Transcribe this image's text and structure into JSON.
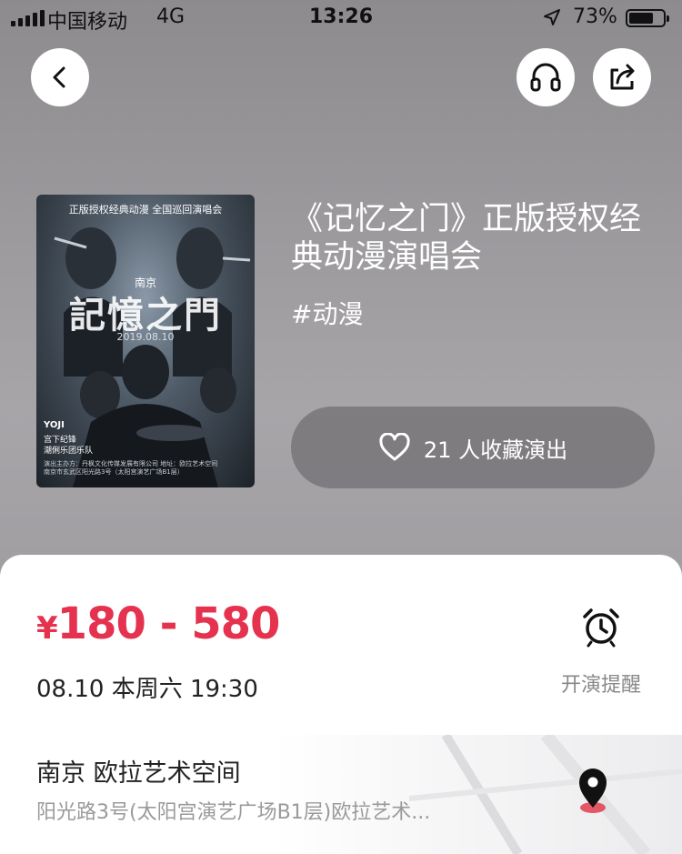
{
  "status_bar": {
    "carrier": "中国移动",
    "network": "4G",
    "time": "13:26",
    "battery_pct": "73%",
    "battery_level": 0.73
  },
  "header": {
    "back_icon": "chevron-left-icon",
    "audio_icon": "headphones-icon",
    "share_icon": "share-icon"
  },
  "poster": {
    "top_text": "正版授权经典动漫 全国巡回演唱会",
    "city": "南京",
    "title_art": "記憶之門",
    "date": "2019.08.10",
    "artist_1": "YOJI",
    "artist_2": "宫下纪锋",
    "artist_3": "潮俐乐团乐队",
    "fine_print": "演出主办方：丹枫文化传媒发展有限公司 地址：欧拉艺术空间 南京市玄武区阳光路3号（太阳宫演艺广场B1层）"
  },
  "show": {
    "title": "《记忆之门》正版授权经典动漫演唱会",
    "tag": "#动漫",
    "favorite_label": "21 人收藏演出"
  },
  "ticket": {
    "currency": "¥",
    "price_range": "180 - 580",
    "datetime": "08.10 本周六 19:30",
    "reminder_label": "开演提醒"
  },
  "venue": {
    "name": "南京 欧拉艺术空间",
    "address": "阳光路3号(太阳宫演艺广场B1层)欧拉艺术..."
  },
  "colors": {
    "accent_price": "#e5334f",
    "pin_accent": "#e03c4e"
  }
}
